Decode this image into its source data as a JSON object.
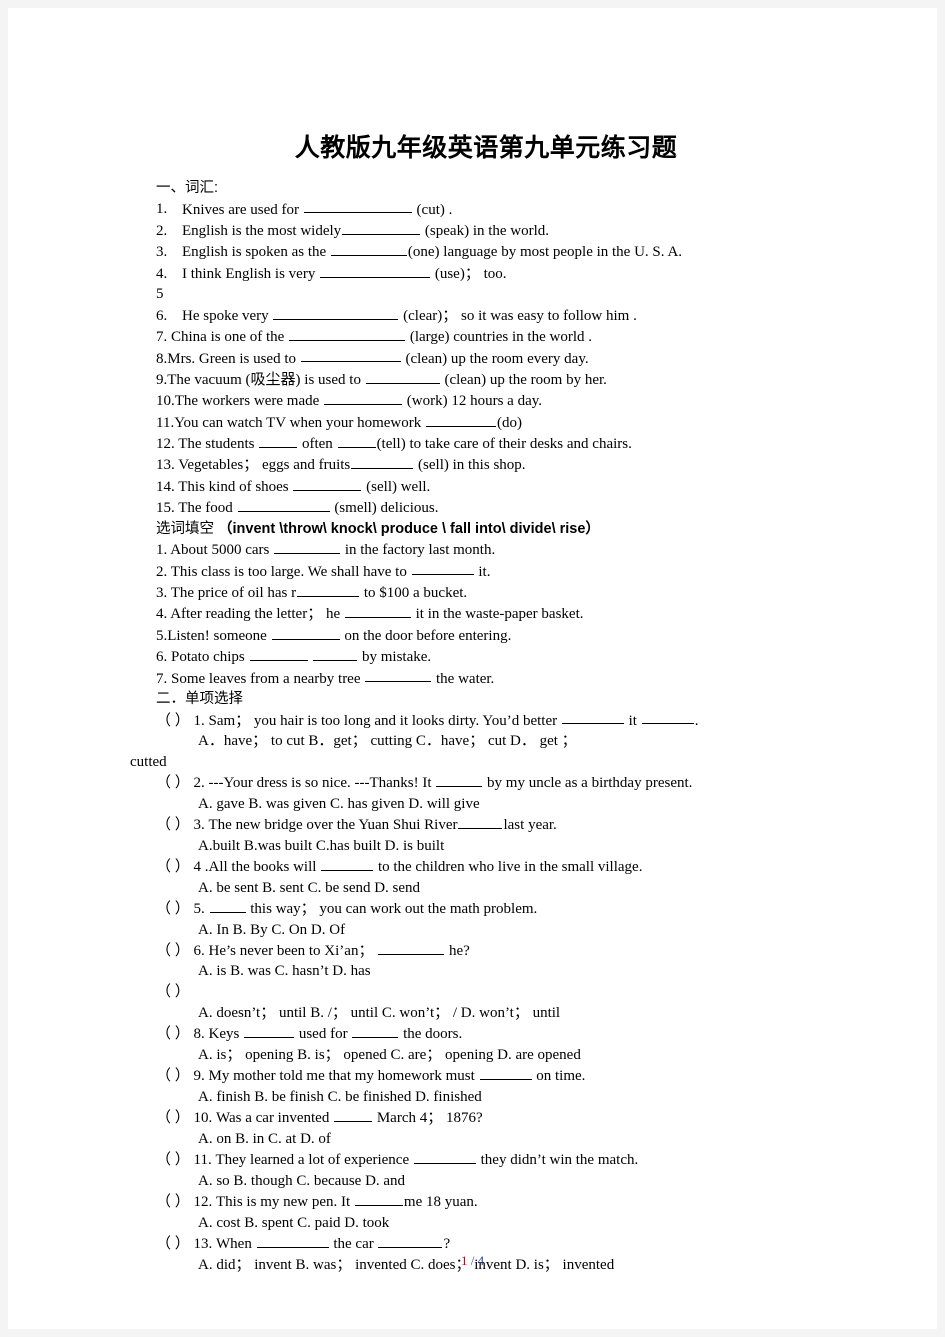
{
  "document": {
    "title": "人教版九年级英语第九单元练习题",
    "footer": {
      "current_page": "1",
      "separator": "/",
      "total_pages": "4"
    }
  },
  "section_one": {
    "heading": "一、词汇:",
    "items": [
      {
        "num": "1.",
        "pre": "Knives are used for",
        "blank_w": 108,
        "post": "(cut) ."
      },
      {
        "num": "2.",
        "pre": "English is the most widely",
        "blank_w": 78,
        "post": "(speak) in the world."
      },
      {
        "num": "3.",
        "pre": "English is spoken as the",
        "blank_w": 76,
        "post": "(one) language by most people in the U. S. A."
      },
      {
        "num": "4.",
        "pre": "I think English is very",
        "blank_w": 110,
        "post": "(use)；  too."
      },
      {
        "num": "5",
        "pre": "",
        "blank_w": 0,
        "post": ""
      },
      {
        "num": "6.",
        "pre": "He spoke very",
        "blank_w": 125,
        "post": "(clear)；  so it was easy to follow him ."
      },
      {
        "num": "7.",
        "pre": "China is one of the",
        "blank_w": 116,
        "post": "(large) countries in the world ."
      },
      {
        "num": "8.",
        "pre": "Mrs. Green is used to",
        "blank_w": 100,
        "post": "(clean) up the room every day."
      },
      {
        "num": "9.",
        "pre": "The vacuum (吸尘器) is used to",
        "blank_w": 74,
        "post": "(clean) up the room by her."
      },
      {
        "num": "10.",
        "pre": "The workers were made",
        "blank_w": 78,
        "post": "(work) 12 hours a day."
      },
      {
        "num": "11.",
        "pre": "You can watch TV when your homework",
        "blank_w": 70,
        "post": "(do)"
      },
      {
        "num": "12.",
        "pre": "The students",
        "blank_w": 38,
        "mid": "often",
        "blank2_w": 38,
        "post": "(tell) to take care of their desks and chairs."
      },
      {
        "num": "13.",
        "pre": "Vegetables；  eggs and fruits",
        "blank_w": 62,
        "post": "(sell) in this shop."
      },
      {
        "num": "14.",
        "pre": "This kind of shoes",
        "blank_w": 68,
        "post": "(sell) well."
      },
      {
        "num": "15.",
        "pre": "The food",
        "blank_w": 92,
        "post": "(smell) delicious."
      }
    ]
  },
  "section_cloze": {
    "heading_cn": "选词填空",
    "heading_words": "（invent \\throw\\ knock\\ produce \\ fall into\\ divide\\   rise）",
    "items": [
      {
        "num": "1.",
        "pre": "About 5000 cars",
        "blank_w": 66,
        "post": "in the factory last month."
      },
      {
        "num": "2.",
        "pre": "This class is too large. We shall have to",
        "blank_w": 62,
        "post": "it."
      },
      {
        "num": "3.",
        "pre": "The price of oil has r",
        "blank_w": 62,
        "post": "to $100 a bucket."
      },
      {
        "num": "4.",
        "pre": "After reading the letter；  he",
        "blank_w": 66,
        "post": "it in the waste-paper basket."
      },
      {
        "num": "5.",
        "pre": "Listen! someone",
        "blank_w": 68,
        "post": "on the door before entering."
      },
      {
        "num": "6.",
        "pre": "Potato chips",
        "blank_w": 58,
        "mid": "",
        "blank2_w": 44,
        "post": "by mistake."
      },
      {
        "num": "7.",
        "pre": "Some leaves from a nearby tree",
        "blank_w": 66,
        "post": "the water."
      }
    ]
  },
  "section_two": {
    "heading": "二．单项选择",
    "questions": [
      {
        "mark": "（    ）",
        "num": "1.",
        "stem_pre": "Sam；  you hair is too long and it looks dirty. You’d better",
        "blank_w": 62,
        "stem_mid": "it",
        "blank2_w": 52,
        "stem_post": ".",
        "options": "A．have；  to cut        B．get；  cutting          C．have；  cut                D． get ；",
        "overflow": "cutted"
      },
      {
        "mark": "（    ）",
        "num": "2.",
        "stem_pre": "---Your dress is so nice. ---Thanks! It",
        "blank_w": 46,
        "stem_post": "by my uncle as a birthday present.",
        "options": "A. gave              B. was given        C. has given                 D. will give"
      },
      {
        "mark": "（    ）",
        "num": "3.",
        "stem_pre": "The new bridge over the Yuan Shui River",
        "blank_w": 44,
        "stem_post": "last year.",
        "options": "A.built          B.was built           C.has built                D. is built"
      },
      {
        "mark": "（    ）",
        "num": "4",
        "stem_pre": ".All the books will",
        "blank_w": 52,
        "stem_post": "to the children who live in the small village.",
        "options": "A. be sent         B. sent          C. be send        D. send"
      },
      {
        "mark": "（    ）",
        "num": "5.",
        "stem_pre": "",
        "blank_w": 36,
        "stem_post": "this way；  you can work out the math problem.",
        "options": "A. In           B. By         C. On          D. Of"
      },
      {
        "mark": "（    ）",
        "num": "6.",
        "stem_pre": "He’s never been to Xi’an；",
        "blank_w": 66,
        "stem_post": "he?",
        "options": "A. is        B. was       C. hasn’t       D. has"
      },
      {
        "mark": "（    ）",
        "num": "",
        "stem_pre": "",
        "blank_w": 0,
        "stem_post": "",
        "options": "A. doesn’t；  until B. /；  until      C. won’t；  /      D. won’t；  until"
      },
      {
        "mark": "（    ）",
        "num": "8.",
        "stem_pre": "Keys",
        "blank_w": 50,
        "stem_mid": "used for",
        "blank2_w": 46,
        "stem_post": "the doors.",
        "options": "A. is；  opening     B. is；  opened      C. are；  opening      D. are opened"
      },
      {
        "mark": "（    ）",
        "num": "9.",
        "stem_pre": "My mother told me that my homework must",
        "blank_w": 52,
        "stem_post": "on time.",
        "options": "A. finish      B. be finish      C. be finished     D. finished"
      },
      {
        "mark": "（    ）",
        "num": "10.",
        "stem_pre": "Was a car invented",
        "blank_w": 38,
        "stem_post": "March 4；  1876?",
        "options": "A. on        B. in       C. at       D. of"
      },
      {
        "mark": "（    ）",
        "num": "11.",
        "stem_pre": "They learned a lot of experience",
        "blank_w": 62,
        "stem_post": "they didn’t win the match.",
        "options": "A. so         B. though      C. because        D. and"
      },
      {
        "mark": "（    ）",
        "num": "12.",
        "stem_pre": "This is my new pen. It",
        "blank_w": 48,
        "stem_post": "me 18 yuan.",
        "options": "A. cost          B. spent        C. paid           D. took"
      },
      {
        "mark": "（    ）",
        "num": "13.",
        "stem_pre": "When",
        "blank_w": 72,
        "stem_mid": "the car",
        "blank2_w": 64,
        "stem_post": "?",
        "options": "A. did；  invent          B. was；  invented  C. does；  invent D. is；  invented"
      }
    ]
  }
}
